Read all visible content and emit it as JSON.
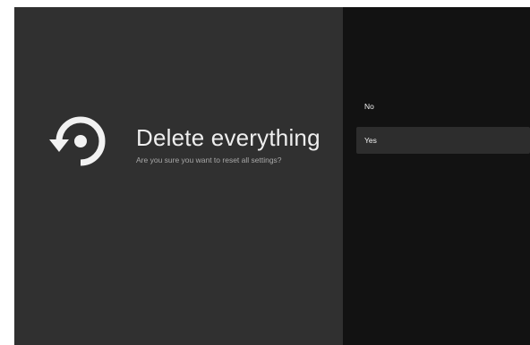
{
  "dialog": {
    "icon": "reset-icon",
    "title": "Delete everything",
    "subtitle": "Are you sure you want to reset all settings?"
  },
  "options": [
    {
      "label": "No",
      "selected": false
    },
    {
      "label": "Yes",
      "selected": true
    }
  ],
  "colors": {
    "left_pane": "#303030",
    "right_pane": "#121212",
    "selected_option": "#2d2d2d",
    "text": "#eeeeee",
    "subtext": "#a8a8a8"
  }
}
